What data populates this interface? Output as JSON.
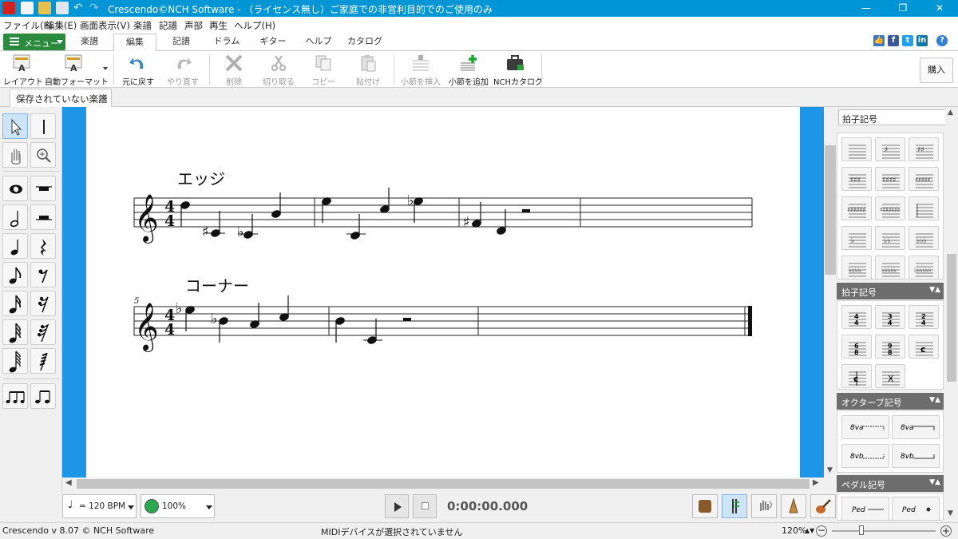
{
  "window": {
    "title": "Crescendo©NCH Software - （ライセンス無し）ご家庭での非営利目的でのご使用のみ",
    "minimize": "—",
    "maximize": "❐",
    "close": "✕"
  },
  "menubar": [
    "ファイル(F)",
    "編集(E)",
    "画面表示(V)",
    "楽譜",
    "記譜",
    "声部",
    "再生",
    "ヘルプ(H)"
  ],
  "ribbon": {
    "menu_label": "メニュー",
    "tabs": [
      "楽譜",
      "編集",
      "記譜",
      "ドラム",
      "ギター",
      "ヘルプ",
      "カタログ"
    ],
    "active_tab": "編集"
  },
  "toolbar": {
    "layout": "レイアウト",
    "auto_format": "自動フォーマット",
    "undo": "元に戻す",
    "redo": "やり直す",
    "delete": "削除",
    "cut": "切り取る",
    "copy": "コピー",
    "paste": "貼付け",
    "insert_bar": "小節を挿入",
    "add_bar": "小節を追加",
    "nch_catalog": "NCHカタログ",
    "buy": "購入"
  },
  "document_tab": {
    "title": "保存されていない楽譜",
    "close": "×"
  },
  "score": {
    "line1_lyric": "エッジ",
    "line2_lyric": "コーナー",
    "line2_measure_number": "5",
    "time_signature_top": "4",
    "time_signature_bottom": "4"
  },
  "right_panel": {
    "dropdown_value": "拍子記号",
    "sections": [
      "拍子記号",
      "オクターブ記号",
      "ペダル記号"
    ],
    "collapse_arrows": "▼▲"
  },
  "transport": {
    "tempo": "= 120 BPM",
    "volume": "100%",
    "time": "0:00:00.000"
  },
  "status": {
    "version": "Crescendo v 8.07 © NCH Software",
    "midi": "MIDIデバイスが選択されていません",
    "zoom": "120%"
  },
  "colors": {
    "titlebar": "#0096d6",
    "menu_button": "#2a8a3e",
    "score_background": "#1e96e8",
    "section_header": "#6d6d6d"
  }
}
